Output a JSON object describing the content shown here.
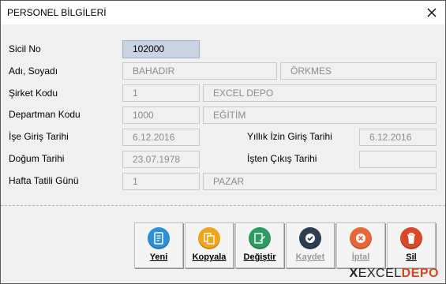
{
  "window": {
    "title": "PERSONEL BİLGİLERİ",
    "close_icon": "close-icon"
  },
  "form": {
    "sicil_no": {
      "label": "Sicil No",
      "value": "102000"
    },
    "ad_soyad": {
      "label": "Adı, Soyadı",
      "first_name": "BAHADIR",
      "last_name": "ÖRKMES"
    },
    "sirket": {
      "label": "Şirket Kodu",
      "code": "1",
      "name": "EXCEL DEPO"
    },
    "departman": {
      "label": "Departman Kodu",
      "code": "1000",
      "name": "EĞİTİM"
    },
    "ise_giris": {
      "label": "İşe Giriş Tarihi",
      "value": "6.12.2016"
    },
    "yillik_izin": {
      "label": "Yıllık İzin Giriş Tarihi",
      "value": "6.12.2016"
    },
    "dogum": {
      "label": "Doğum Tarihi",
      "value": "23.07.1978"
    },
    "isten_cikis": {
      "label": "İşten Çıkış Tarihi",
      "value": ""
    },
    "hafta_tatili": {
      "label": "Hafta Tatili Günü",
      "code": "1",
      "name": "PAZAR"
    }
  },
  "buttons": {
    "yeni": {
      "label": "Yeni",
      "icon": "document-icon",
      "color": "#2f8fd6"
    },
    "kopyala": {
      "label": "Kopyala",
      "icon": "copy-icon",
      "color": "#f0a61c"
    },
    "degistir": {
      "label": "Değiştir",
      "icon": "edit-icon",
      "color": "#2e9b63"
    },
    "kaydet": {
      "label": "Kaydet",
      "icon": "check-icon",
      "color": "#2c3e50"
    },
    "iptal": {
      "label": "İptal",
      "icon": "cancel-icon",
      "color": "#e8673a"
    },
    "sil": {
      "label": "Sil",
      "icon": "trash-icon",
      "color": "#d9482b"
    }
  },
  "branding": {
    "logo_prefix": "X",
    "logo_excel": "EXCEL",
    "logo_depo": "DEPO"
  }
}
